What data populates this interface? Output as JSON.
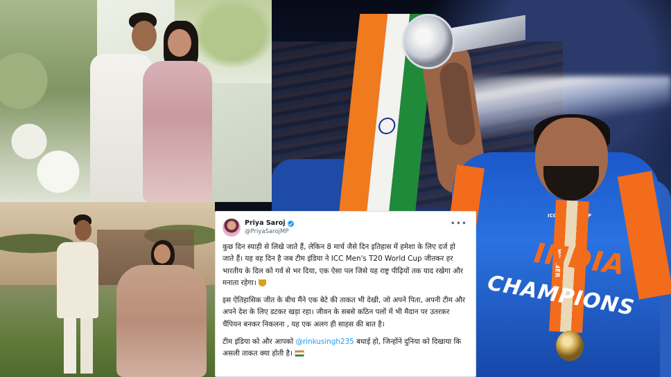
{
  "tweet": {
    "display_name": "Priya Saroj",
    "handle": "@PriyaSarojMP",
    "more_icon": "more-horizontal-icon",
    "paragraph_1": "कुछ दिन स्याही से लिखे जाते हैं, लेकिन 8 मार्च जैसे दिन इतिहास में हमेशा के लिए दर्ज हो जाते हैं। यह वह दिन है जब टीम इंडिया ने ICC Men's T20 World Cup जीतकर हर भारतीय के दिल को गर्व से भर दिया, एक ऐसा पल जिसे यह राष्ट्र पीढ़ियों तक याद रखेगा और मनाता रहेगा।",
    "paragraph_2": "इस ऐतिहासिक जीत के बीच मैंने एक बेटे की ताकत भी देखी, जो अपने पिता, अपनी टीम और अपने देश के लिए डटकर खड़ा रहा। जीवन के सबसे कठिन पलों में भी मैदान पर उतरकर चैंपियन बनकर निकलना , यह एक अलग ही साहस की बात है।",
    "paragraph_3_pre": "टीम इंडिया को और आपको ",
    "mention": "@rinkusingh235",
    "paragraph_3_post": " बधाई हो, जिन्होंने दुनिया को दिखाया कि असली ताकत क्या होती है।",
    "accent_color": "#1d9bf0"
  },
  "jersey": {
    "team_text": "INDIA",
    "champions_text": "CHAMPIONS",
    "medal_text": "WINNER",
    "logo_text": "ICC WORLD CUP"
  },
  "colors": {
    "saffron": "#f07a1e",
    "green": "#1f8a3a",
    "jersey_blue": "#1c58c9",
    "jersey_orange": "#f36c1c"
  }
}
